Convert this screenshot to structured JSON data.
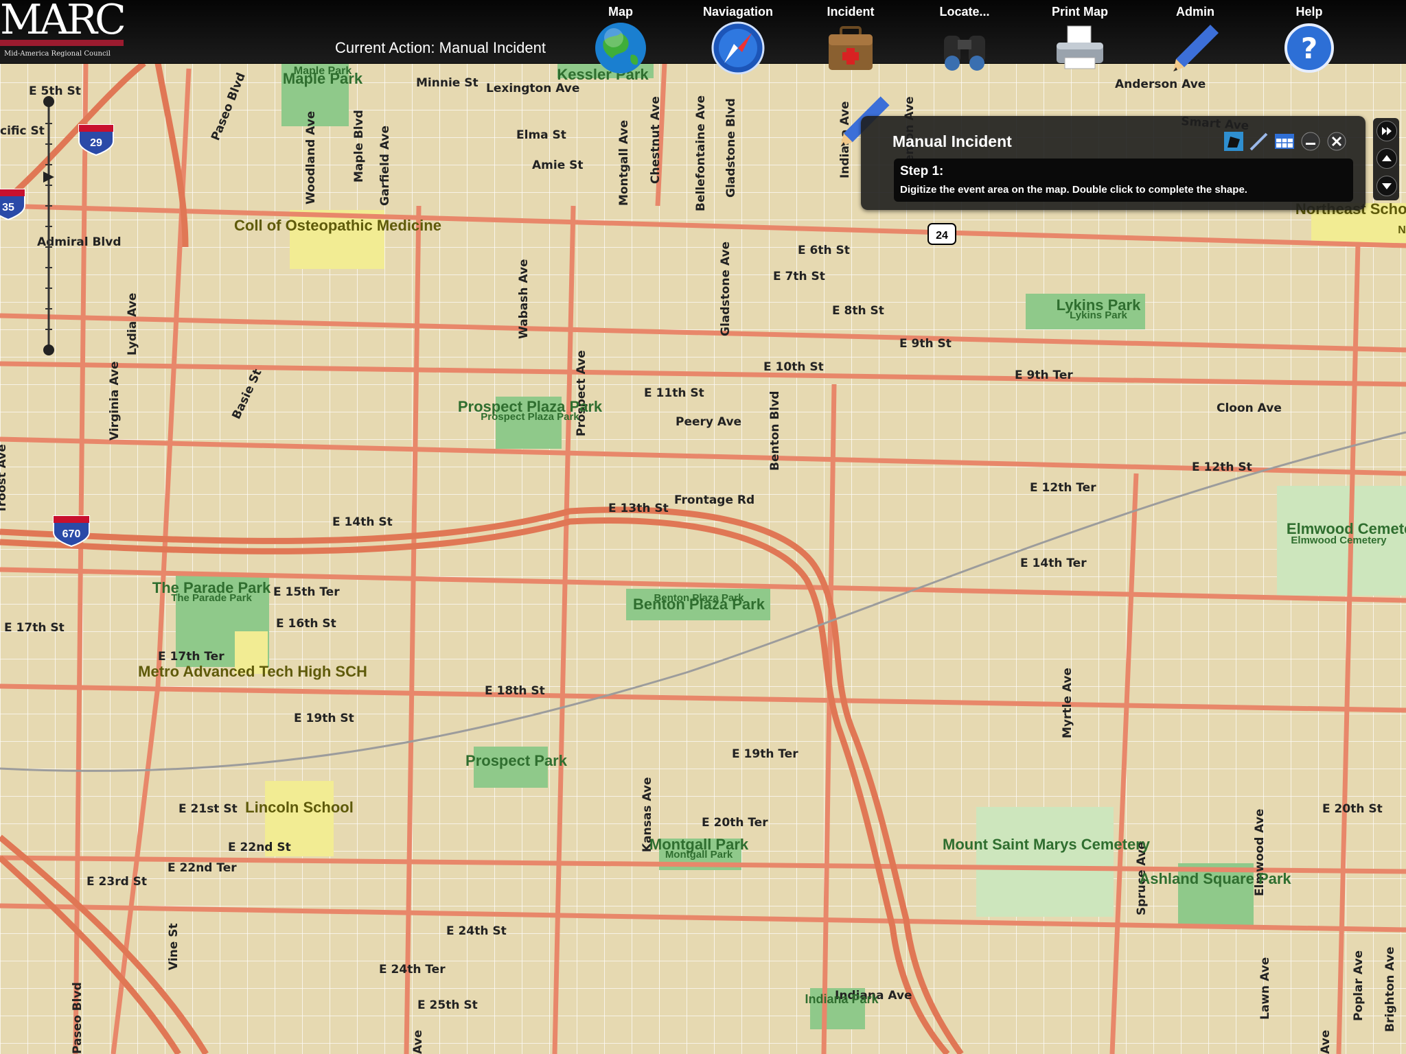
{
  "app": {
    "logo_text": "MARC",
    "logo_subtitle": "Mid-America Regional Council",
    "current_action": "Current Action: Manual Incident"
  },
  "menu": [
    {
      "label": "Map",
      "icon": "globe-icon"
    },
    {
      "label": "Naviagation",
      "icon": "compass-icon"
    },
    {
      "label": "Incident",
      "icon": "first-aid-kit-icon"
    },
    {
      "label": "Locate...",
      "icon": "binoculars-icon"
    },
    {
      "label": "Print Map",
      "icon": "printer-icon"
    },
    {
      "label": "Admin",
      "icon": "pencil-icon"
    },
    {
      "label": "Help",
      "icon": "help-icon"
    }
  ],
  "panel": {
    "title": "Manual Incident",
    "step_title": "Step 1:",
    "step_text": "Digitize the event area on the map. Double click to complete the shape.",
    "tools": [
      "polygon-tool-icon",
      "line-tool-icon",
      "table-icon",
      "minimize-icon",
      "close-icon"
    ]
  },
  "side_controls": [
    "fast-forward-icon",
    "up-arrow-icon",
    "down-arrow-icon"
  ],
  "colors": {
    "map_background": "#e6d9b1",
    "major_road": "#e8876a",
    "minor_road": "#ffffff",
    "park": "#8fc98a",
    "school": "#f2ec93",
    "interstate_shield": "#2a4aa8",
    "logo_red": "#9b1b2f"
  },
  "map": {
    "street_labels": [
      "E 5th St",
      "Minnie St",
      "Lexington Ave",
      "Elma St",
      "Amie St",
      "Admiral Blvd",
      "E 6th St",
      "E 7th St",
      "E 8th St",
      "E 9th St",
      "E 9th Ter",
      "E 10th St",
      "E 11th St",
      "Peery Ave",
      "Cloon Ave",
      "E 12th St",
      "E 12th Ter",
      "Frontage Rd",
      "E 13th St",
      "E 14th St",
      "E 14th Ter",
      "E 15th Ter",
      "E 16th St",
      "E 17th St",
      "E 17th Ter",
      "E 18th St",
      "E 19th St",
      "E 19th Ter",
      "E 20th Ter",
      "E 20th St",
      "E 21st St",
      "E 22nd St",
      "E 22nd Ter",
      "E 23rd St",
      "E 24th St",
      "E 24th Ter",
      "E 25th St",
      "Anderson Ave",
      "Smart Ave",
      "Paseo Blvd",
      "Woodland Ave",
      "Maple Blvd",
      "Garfield Ave",
      "Montgall Ave",
      "Chestnut Ave",
      "Bellefontaine Ave",
      "Gladstone Blvd",
      "Gladstone Ave",
      "Wabash Ave",
      "Prospect Ave",
      "Benton Blvd",
      "Lydia Ave",
      "Virginia Ave",
      "Basie St",
      "Kansas Ave",
      "Myrtle Ave",
      "Spruce Ave",
      "Elmwood Ave",
      "Lawn Ave",
      "Poplar Ave",
      "Brighton Ave",
      "Vine St",
      "Indiana Ave",
      "cific St",
      "Troost Ave",
      "Paseo Blvd",
      "Ave",
      "Ave",
      "Benton Ave",
      "Indiana Ave"
    ],
    "place_labels": [
      "Maple Park",
      "Maple Park",
      "Kessler Park",
      "Coll of Osteopathic Medicine",
      "Lykins Park",
      "Lykins Park",
      "Prospect Plaza Park",
      "Prospect Plaza Park",
      "Benton Plaza Park",
      "Benton Plaza Park",
      "The Parade Park",
      "The Parade Park",
      "Metro Advanced Tech High SCH",
      "Prospect Park",
      "Lincoln School",
      "Montgall Park",
      "Montgall Park",
      "Mount Saint Marys Cemetery",
      "Ashland Square Park",
      "Elmwood Cemetery",
      "Elmwood Cemetery",
      "Indiana Park",
      "Northeast School",
      "N"
    ],
    "shields": [
      "29",
      "35",
      "670",
      "24"
    ]
  }
}
